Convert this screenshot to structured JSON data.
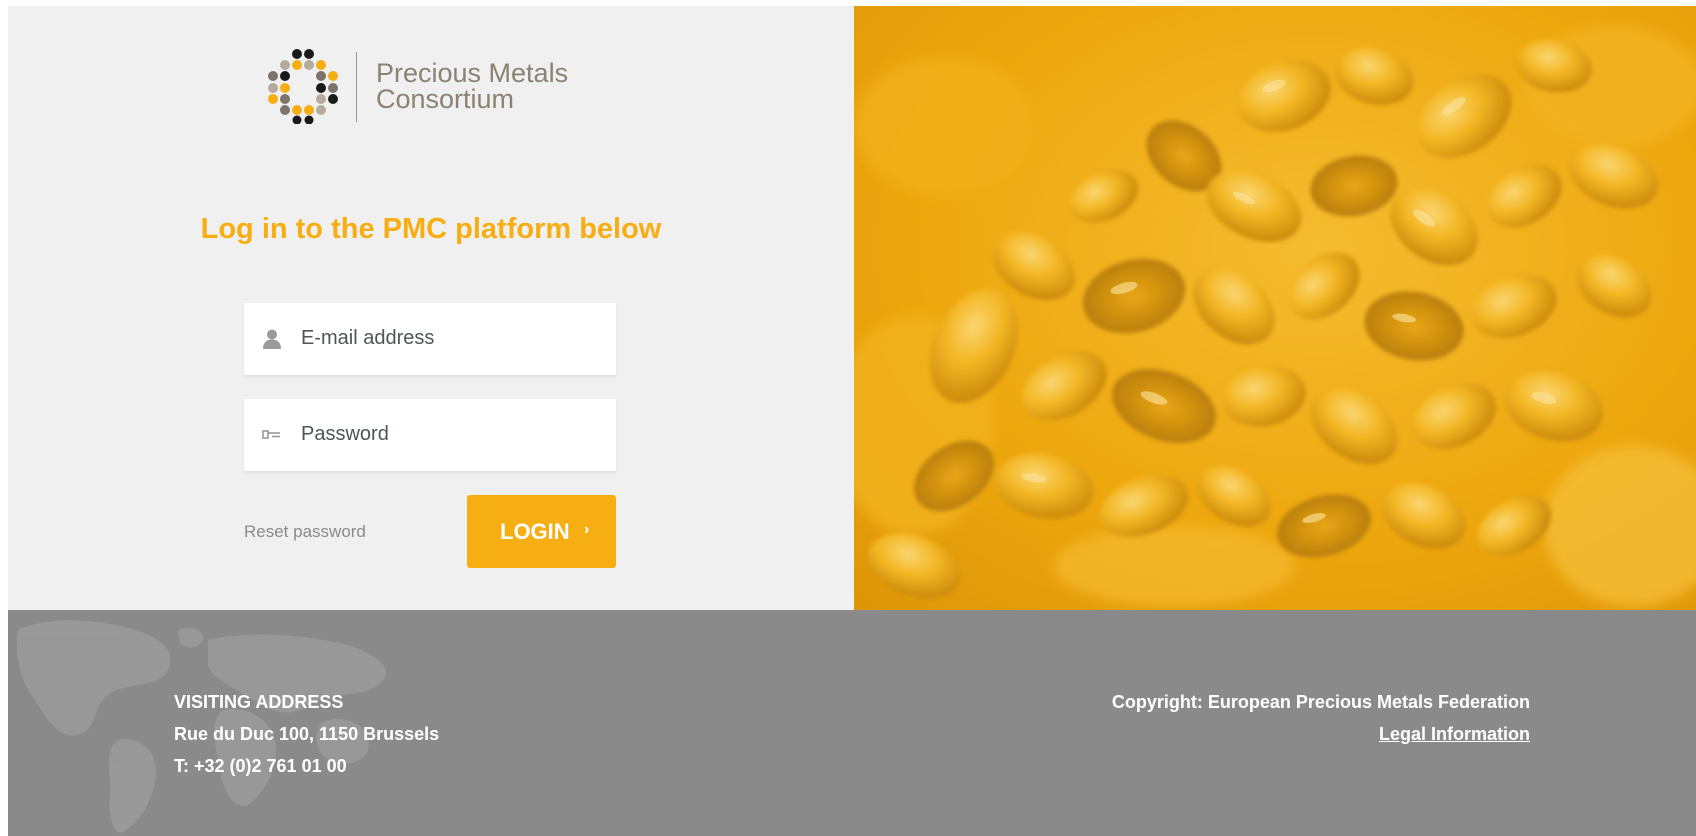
{
  "brand": {
    "name_line1": "Precious Metals",
    "name_line2": "Consortium",
    "logo_icon": "dotted-diamond-logo",
    "dot_colors": [
      "#1a1a1a",
      "#7d7369",
      "#b5aa9b",
      "#f6ae13"
    ]
  },
  "login": {
    "heading": "Log in to the PMC platform below",
    "email_placeholder": "E-mail address",
    "email_icon": "user-icon",
    "password_placeholder": "Password",
    "password_icon": "key-icon",
    "reset_label": "Reset password",
    "button_label": "LOGIN",
    "button_chevron": "›"
  },
  "footer": {
    "address_title": "VISITING ADDRESS",
    "address_street": "Rue du Duc 100, 1150 Brussels",
    "address_phone": "T: +32 (0)2 761 01 00",
    "copyright": "Copyright: European Precious Metals Federation",
    "legal_link": "Legal Information",
    "background_icon": "world-map"
  },
  "colors": {
    "accent": "#f6ae13",
    "panel_bg": "#f0f0f0",
    "footer_bg": "#8a8a8a",
    "hero_gold": "#efa90c"
  }
}
